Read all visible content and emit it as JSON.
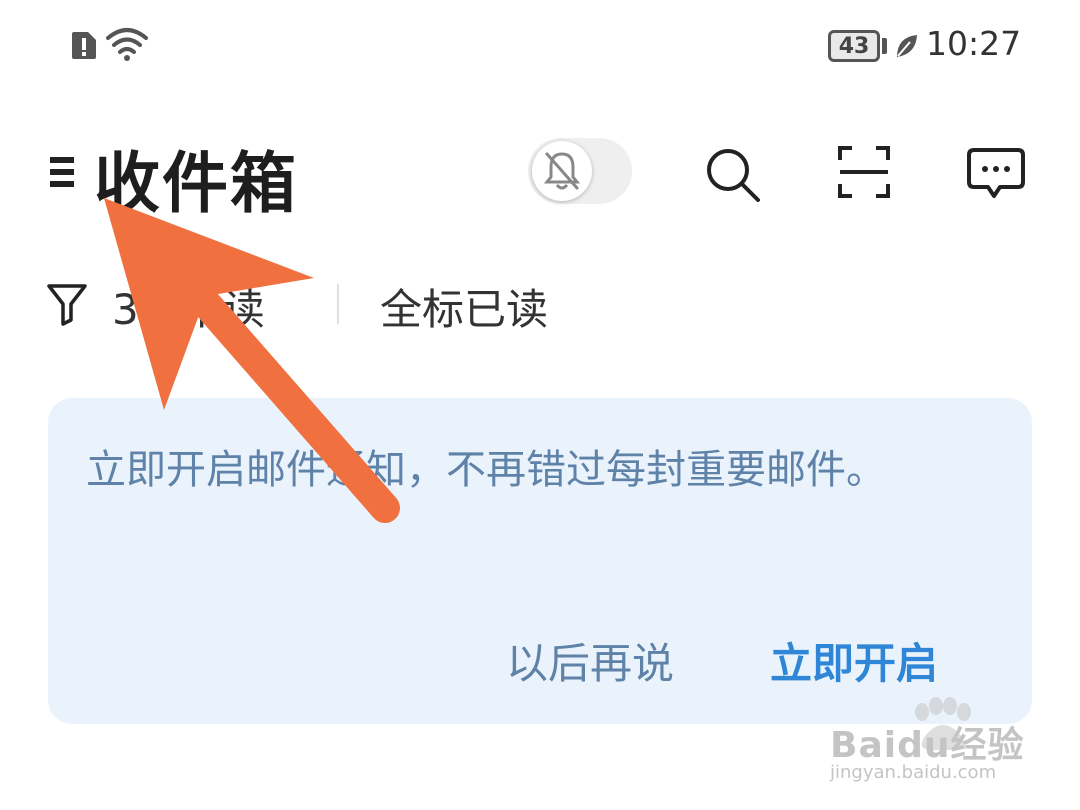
{
  "status_bar": {
    "battery_level": "43",
    "time": "10:27",
    "icons": [
      "sim-alert-icon",
      "wifi-icon",
      "battery-icon",
      "eco-leaf-icon"
    ]
  },
  "header": {
    "title": "收件箱",
    "icons": [
      "menu-icon",
      "bell-off-icon",
      "search-icon",
      "scan-icon",
      "message-icon"
    ]
  },
  "filter_bar": {
    "unread_label": "3封未读",
    "mark_all_read": "全标已读"
  },
  "notification_banner": {
    "message": "立即开启邮件通知，不再错过每封重要邮件。",
    "later_button": "以后再说",
    "enable_button": "立即开启"
  },
  "watermark": {
    "brand": "Baidu经验",
    "url": "jingyan.baidu.com"
  },
  "colors": {
    "banner_bg": "#eaf3fc",
    "banner_text": "#5f82a8",
    "accent_blue": "#2f86d6",
    "arrow_orange": "#f0703f"
  }
}
